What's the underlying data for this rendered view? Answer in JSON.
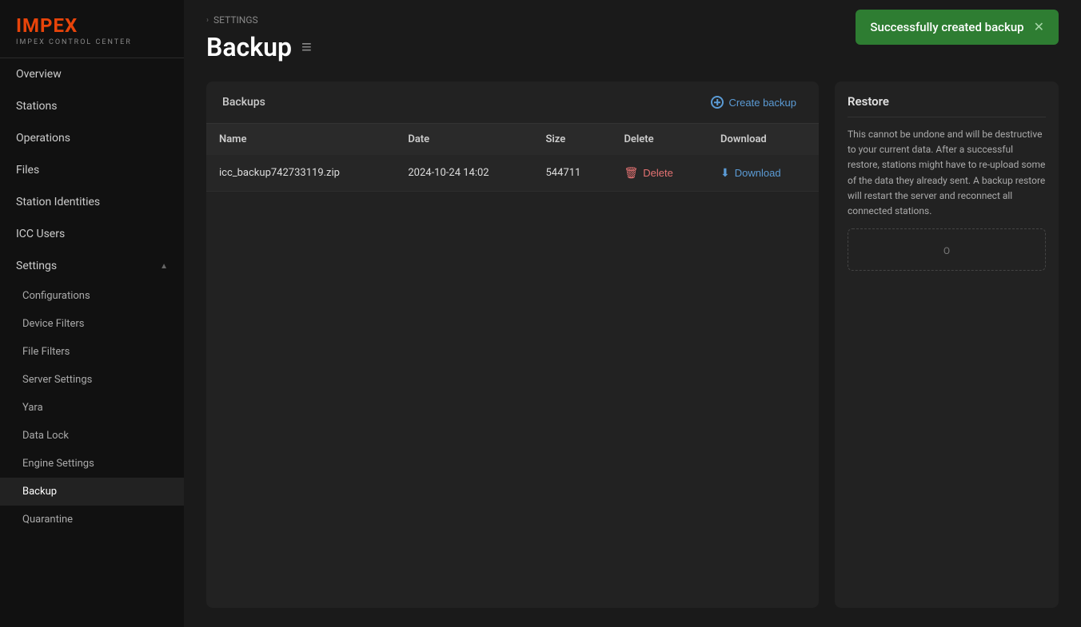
{
  "app": {
    "name": "IMPEX",
    "subtitle": "IMPEX CONTROL CENTER"
  },
  "sidebar": {
    "nav_items": [
      {
        "id": "overview",
        "label": "Overview",
        "active": false
      },
      {
        "id": "stations",
        "label": "Stations",
        "active": false
      },
      {
        "id": "operations",
        "label": "Operations",
        "active": false
      },
      {
        "id": "files",
        "label": "Files",
        "active": false
      },
      {
        "id": "station-identities",
        "label": "Station Identities",
        "active": false
      },
      {
        "id": "icc-users",
        "label": "ICC Users",
        "active": false
      }
    ],
    "settings": {
      "label": "Settings",
      "expanded": true,
      "sub_items": [
        {
          "id": "configurations",
          "label": "Configurations",
          "active": false
        },
        {
          "id": "device-filters",
          "label": "Device Filters",
          "active": false
        },
        {
          "id": "file-filters",
          "label": "File Filters",
          "active": false
        },
        {
          "id": "server-settings",
          "label": "Server Settings",
          "active": false
        },
        {
          "id": "yara",
          "label": "Yara",
          "active": false
        },
        {
          "id": "data-lock",
          "label": "Data Lock",
          "active": false
        },
        {
          "id": "engine-settings",
          "label": "Engine Settings",
          "active": false
        },
        {
          "id": "backup",
          "label": "Backup",
          "active": true
        },
        {
          "id": "quarantine",
          "label": "Quarantine",
          "active": false
        }
      ]
    }
  },
  "breadcrumb": {
    "items": [
      "SETTINGS"
    ]
  },
  "page": {
    "title": "Backup",
    "title_icon": "≡"
  },
  "toast": {
    "message": "Successfully created backup",
    "close_label": "✕",
    "color": "#2e7d32"
  },
  "backup_panel": {
    "title": "Backups",
    "create_btn": "Create backup",
    "table": {
      "headers": [
        "Name",
        "Date",
        "Size",
        "Delete",
        "Download"
      ],
      "rows": [
        {
          "name": "icc_backup742733119.zip",
          "date": "2024-10-24 14:02",
          "size": "544711",
          "delete_label": "Delete",
          "download_label": "Download"
        }
      ]
    }
  },
  "restore_panel": {
    "title": "Restore",
    "description": "This cannot be undone and will be destructive to your current data. After a successful restore, stations might have to re-upload some of the data they already sent. A backup restore will restart the server and reconnect all connected stations.",
    "upload_label": "O"
  }
}
